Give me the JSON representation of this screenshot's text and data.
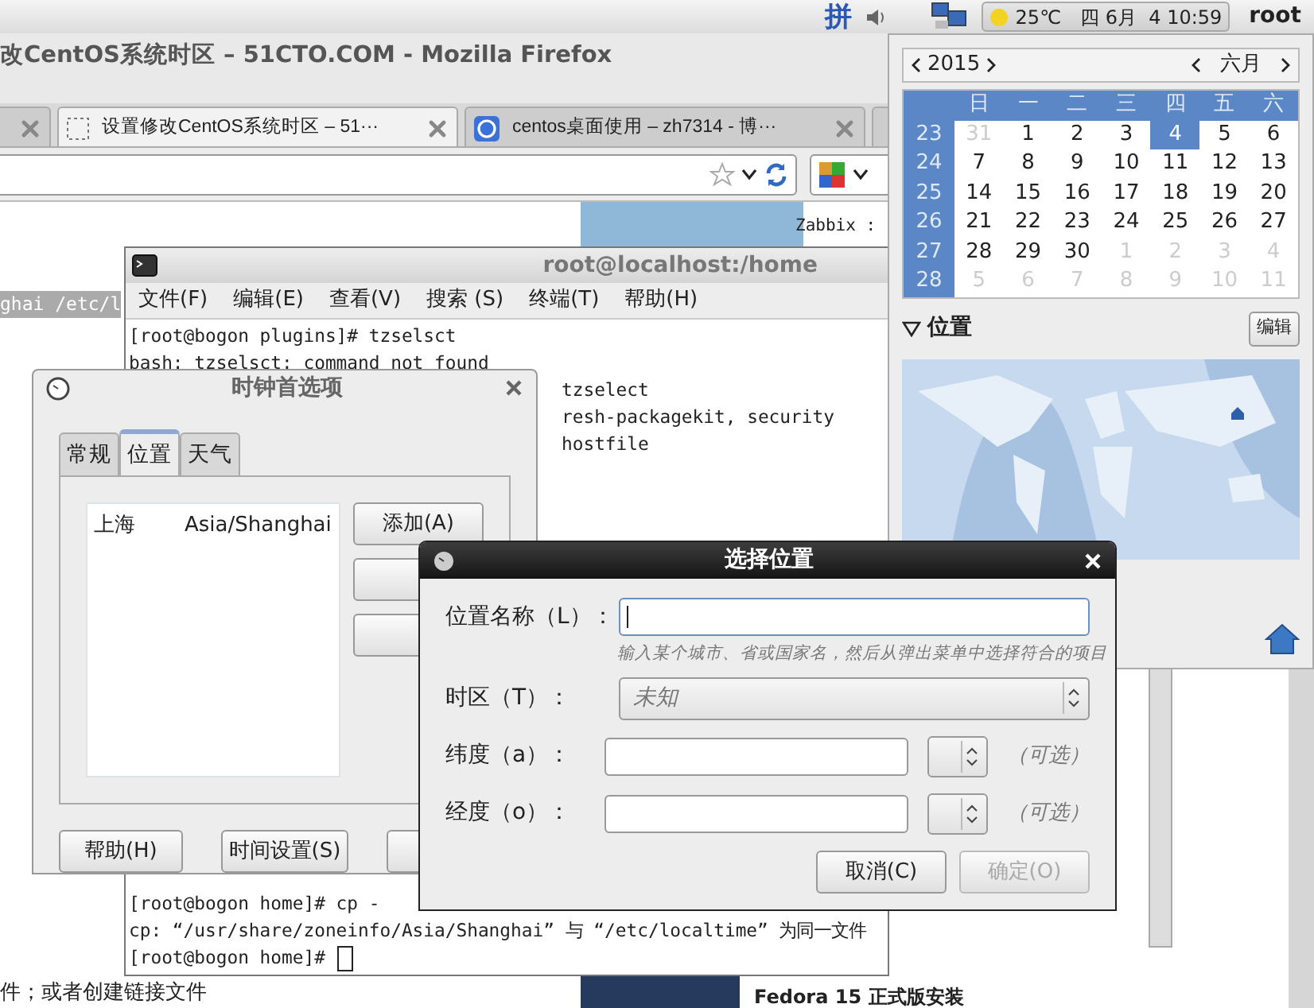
{
  "top_panel": {
    "input_method": "拼",
    "temperature": "25℃",
    "clock": "四 6月  4 10:59",
    "user": "root"
  },
  "browser": {
    "title": "改CentOS系统时区 – 51CTO.COM - Mozilla Firefox",
    "tabs": [
      {
        "kind": "cut",
        "selected": false
      },
      {
        "kind": "full",
        "label": "设置修改CentOS系统时区 – 51···",
        "selected": true
      },
      {
        "kind": "full",
        "label": "centos桌面使用 – zh7314 - 博···",
        "selected": false
      },
      {
        "kind": "cut",
        "selected": false
      }
    ],
    "page": {
      "selected_text": "ghai /etc/l",
      "sidebar_caption": "Zabbix :",
      "footer_text": "件；或者创建链接文件",
      "article_title": "Fedora 15 正式版安装"
    }
  },
  "terminal": {
    "title": "root@localhost:/home",
    "menu": [
      "文件(F)",
      "编辑(E)",
      "查看(V)",
      "搜索 (S)",
      "终端(T)",
      "帮助(H)"
    ],
    "lines": [
      {
        "kind": "full",
        "text": "[root@bogon plugins]# tzselsct"
      },
      {
        "kind": "full",
        "text": "bash: tzselsct: command not found"
      },
      {
        "kind": "cut",
        "text": "tzselect"
      },
      {
        "kind": "cut",
        "text": "resh-packagekit, security"
      },
      {
        "kind": "cut",
        "text": "hostfile"
      },
      {
        "kind": "gap"
      },
      {
        "kind": "full",
        "text": "[root@bogon home]# cp -"
      },
      {
        "kind": "full",
        "text": "cp: “/usr/share/zoneinfo/Asia/Shanghai” 与 “/etc/localtime” 为同一文件"
      },
      {
        "kind": "prompt",
        "text": "[root@bogon home]#"
      }
    ]
  },
  "clock_preferences": {
    "title": "时钟首选项",
    "tabs": [
      {
        "label": "常规",
        "selected": false
      },
      {
        "label": "位置",
        "selected": true
      },
      {
        "label": "天气",
        "selected": false
      }
    ],
    "locations": [
      {
        "name": "上海",
        "timezone": "Asia/Shanghai"
      }
    ],
    "side_buttons": [
      {
        "kind": "full",
        "label": "添加(A)"
      },
      {
        "kind": "covered"
      },
      {
        "kind": "covered"
      }
    ],
    "bottom_buttons": [
      {
        "kind": "full",
        "label": "帮助(H)"
      },
      {
        "kind": "full",
        "label": "时间设置(S)"
      },
      {
        "kind": "covered"
      }
    ]
  },
  "location_dialog": {
    "title": "选择位置",
    "name_label": "位置名称（L）：",
    "hint": "输入某个城市、省或国家名，然后从弹出菜单中选择符合的项目",
    "timezone_label": "时区（T）：",
    "timezone_value": "未知",
    "latitude_label": "纬度（a）：",
    "latitude_optional": "（可选）",
    "longitude_label": "经度（o）：",
    "longitude_optional": "（可选）",
    "buttons": [
      {
        "label": "取消(C)",
        "disabled": false
      },
      {
        "label": "确定(O)",
        "disabled": true
      }
    ]
  },
  "calendar": {
    "year": "2015",
    "month": "六月",
    "weekdays": [
      "日",
      "一",
      "二",
      "三",
      "四",
      "五",
      "六"
    ],
    "weeks": [
      {
        "number": "23",
        "days": [
          {
            "day": "31",
            "other_month": true,
            "selected": false
          },
          {
            "day": "1",
            "other_month": false,
            "selected": false
          },
          {
            "day": "2",
            "other_month": false,
            "selected": false
          },
          {
            "day": "3",
            "other_month": false,
            "selected": false
          },
          {
            "day": "4",
            "other_month": false,
            "selected": true
          },
          {
            "day": "5",
            "other_month": false,
            "selected": false
          },
          {
            "day": "6",
            "other_month": false,
            "selected": false
          }
        ]
      },
      {
        "number": "24",
        "days": [
          {
            "day": "7",
            "other_month": false,
            "selected": false
          },
          {
            "day": "8",
            "other_month": false,
            "selected": false
          },
          {
            "day": "9",
            "other_month": false,
            "selected": false
          },
          {
            "day": "10",
            "other_month": false,
            "selected": false
          },
          {
            "day": "11",
            "other_month": false,
            "selected": false
          },
          {
            "day": "12",
            "other_month": false,
            "selected": false
          },
          {
            "day": "13",
            "other_month": false,
            "selected": false
          }
        ]
      },
      {
        "number": "25",
        "days": [
          {
            "day": "14",
            "other_month": false,
            "selected": false
          },
          {
            "day": "15",
            "other_month": false,
            "selected": false
          },
          {
            "day": "16",
            "other_month": false,
            "selected": false
          },
          {
            "day": "17",
            "other_month": false,
            "selected": false
          },
          {
            "day": "18",
            "other_month": false,
            "selected": false
          },
          {
            "day": "19",
            "other_month": false,
            "selected": false
          },
          {
            "day": "20",
            "other_month": false,
            "selected": false
          }
        ]
      },
      {
        "number": "26",
        "days": [
          {
            "day": "21",
            "other_month": false,
            "selected": false
          },
          {
            "day": "22",
            "other_month": false,
            "selected": false
          },
          {
            "day": "23",
            "other_month": false,
            "selected": false
          },
          {
            "day": "24",
            "other_month": false,
            "selected": false
          },
          {
            "day": "25",
            "other_month": false,
            "selected": false
          },
          {
            "day": "26",
            "other_month": false,
            "selected": false
          },
          {
            "day": "27",
            "other_month": false,
            "selected": false
          }
        ]
      },
      {
        "number": "27",
        "days": [
          {
            "day": "28",
            "other_month": false,
            "selected": false
          },
          {
            "day": "29",
            "other_month": false,
            "selected": false
          },
          {
            "day": "30",
            "other_month": false,
            "selected": false
          },
          {
            "day": "1",
            "other_month": true,
            "selected": false
          },
          {
            "day": "2",
            "other_month": true,
            "selected": false
          },
          {
            "day": "3",
            "other_month": true,
            "selected": false
          },
          {
            "day": "4",
            "other_month": true,
            "selected": false
          }
        ]
      },
      {
        "number": "28",
        "days": [
          {
            "day": "5",
            "other_month": true,
            "selected": false
          },
          {
            "day": "6",
            "other_month": true,
            "selected": false
          },
          {
            "day": "7",
            "other_month": true,
            "selected": false
          },
          {
            "day": "8",
            "other_month": true,
            "selected": false
          },
          {
            "day": "9",
            "other_month": true,
            "selected": false
          },
          {
            "day": "10",
            "other_month": true,
            "selected": false
          },
          {
            "day": "11",
            "other_month": true,
            "selected": false
          }
        ]
      }
    ],
    "location_section": {
      "title": "位置",
      "expanded": true,
      "edit_button": "编辑"
    }
  }
}
